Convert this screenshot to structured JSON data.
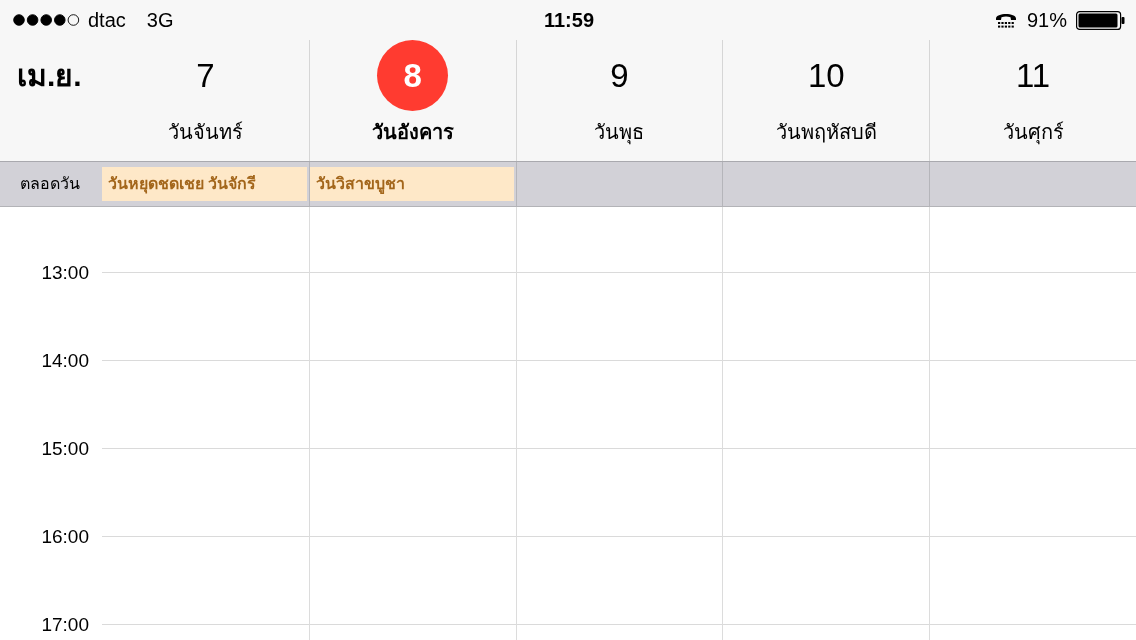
{
  "status_bar": {
    "carrier": "dtac",
    "network": "3G",
    "time": "11:59",
    "battery_percent": "91%"
  },
  "week_header": {
    "month": "เม.ย.",
    "days": [
      {
        "number": "7",
        "name": "วันจันทร์",
        "selected": false,
        "all_day_events": [
          "วันหยุดชดเชย วันจักรี"
        ]
      },
      {
        "number": "8",
        "name": "วันอังคาร",
        "selected": true,
        "all_day_events": [
          "วันวิสาขบูชา"
        ]
      },
      {
        "number": "9",
        "name": "วันพุธ",
        "selected": false
      },
      {
        "number": "10",
        "name": "วันพฤหัสบดี",
        "selected": false
      },
      {
        "number": "11",
        "name": "วันศุกร์",
        "selected": false
      }
    ]
  },
  "all_day": {
    "label": "ตลอดวัน"
  },
  "timeline": {
    "hours": [
      "13:00",
      "14:00",
      "15:00",
      "16:00",
      "17:00"
    ]
  }
}
